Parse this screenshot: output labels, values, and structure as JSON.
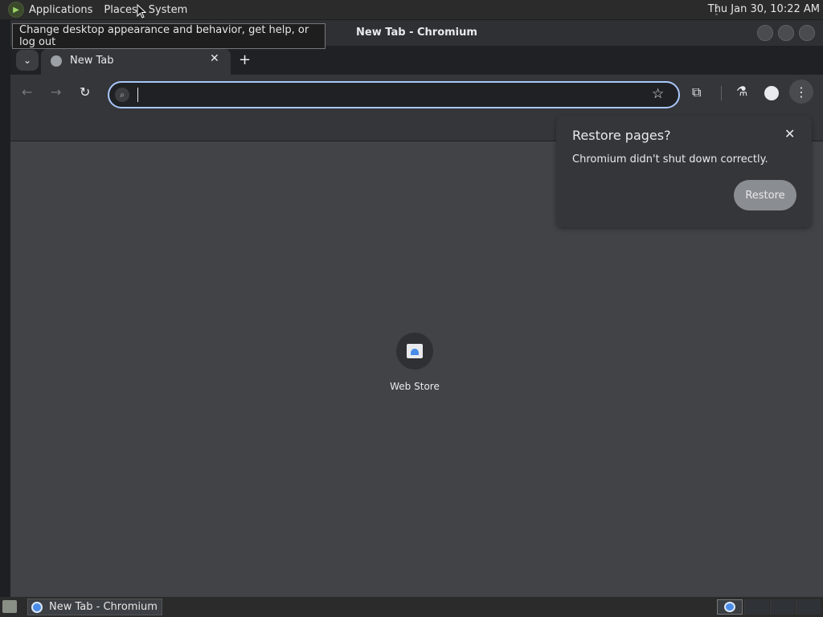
{
  "top_panel": {
    "menus": [
      "Applications",
      "Places",
      "System"
    ],
    "clock": "Thu Jan 30, 10:22 AM"
  },
  "tooltip": "Change desktop appearance and behavior, get help, or log out",
  "window": {
    "title": "New Tab - Chromium",
    "tab": {
      "label": "New Tab"
    },
    "new_tab_symbol": "+",
    "omnibox": {
      "value": "",
      "placeholder": ""
    }
  },
  "content": {
    "shortcut": {
      "label": "Web Store"
    }
  },
  "restore_popup": {
    "title": "Restore pages?",
    "message": "Chromium didn't shut down correctly.",
    "button": "Restore"
  },
  "taskbar": {
    "item_label": "New Tab - Chromium"
  },
  "colors": {
    "accent": "#a8c7fa",
    "content_bg": "#424347",
    "toolbar_bg": "#35363a"
  },
  "icons": {
    "logo": "gnome-foot-icon",
    "search": "search-icon",
    "star": "star-icon",
    "extensions": "puzzle-icon",
    "labs": "flask-icon",
    "profile": "profile-icon",
    "menu": "kebab-menu-icon"
  }
}
